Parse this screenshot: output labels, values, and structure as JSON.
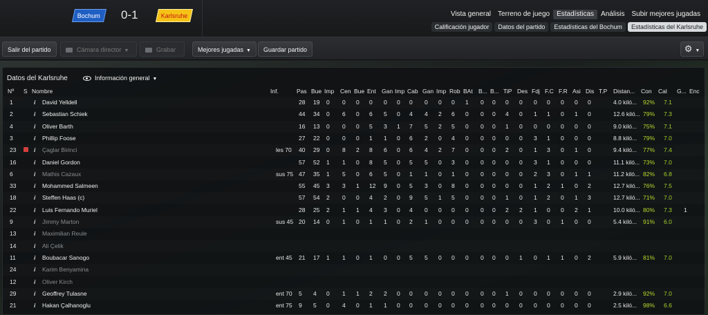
{
  "match": {
    "home_team": "Bochum",
    "away_team": "Karlsruhe",
    "score": "0-1",
    "home_color": "#1f5fc4",
    "away_color": "#f5c216"
  },
  "main_nav": [
    {
      "label": "Vista general",
      "active": false
    },
    {
      "label": "Terreno de juego",
      "active": false
    },
    {
      "label": "Estadísticas",
      "active": true
    },
    {
      "label": "Análisis",
      "active": false
    },
    {
      "label": "Subir mejores jugadas",
      "active": false
    }
  ],
  "sub_nav": [
    {
      "label": "Calificación jugador",
      "active": false
    },
    {
      "label": "Datos del partido",
      "active": false
    },
    {
      "label": "Estadísticas del Bochum",
      "active": false
    },
    {
      "label": "Estadísticas del Karlsruhe",
      "active": true
    }
  ],
  "toolbar": {
    "exit": "Salir del partido",
    "camera": "Cámara director",
    "record": "Grabar",
    "highlights": "Mejores jugadas",
    "save": "Guardar partido"
  },
  "panel": {
    "title": "Datos del Karlsruhe",
    "view": "Información general"
  },
  "columns": [
    "Nº",
    "S",
    "Nombre",
    "Inf.",
    "Pas",
    "Bue",
    "Imp",
    "Cen",
    "Bue",
    "Ent",
    "Gan",
    "Imp",
    "Cab",
    "Gan",
    "Imp",
    "Rob",
    "BAt",
    "B...",
    "B...",
    "TiP",
    "Des",
    "Fdj",
    "F.C",
    "F.R",
    "Asi",
    "Dis",
    "T.P",
    "Distan...",
    "Con",
    "Cal",
    "G...",
    "Enc"
  ],
  "rows": [
    {
      "no": "1",
      "name": "David Yelldell",
      "inf": "",
      "stats": [
        "28",
        "19",
        "0",
        "0",
        "0",
        "0",
        "0",
        "0",
        "0",
        "0",
        "0",
        "0",
        "1",
        "0",
        "0",
        "0",
        "0",
        "0",
        "0",
        "0",
        "0",
        "0"
      ],
      "dist": "4.0 kiló...",
      "con": "92%",
      "cal": "7.1",
      "g": "",
      "enc": "",
      "sub": false,
      "card": false
    },
    {
      "no": "2",
      "name": "Sebastian Schiek",
      "inf": "",
      "stats": [
        "44",
        "34",
        "0",
        "6",
        "0",
        "6",
        "5",
        "0",
        "4",
        "4",
        "2",
        "6",
        "0",
        "0",
        "0",
        "4",
        "0",
        "1",
        "1",
        "0",
        "1",
        "0"
      ],
      "dist": "12.6 kiló...",
      "con": "79%",
      "cal": "7.3",
      "g": "",
      "enc": "",
      "sub": false,
      "card": false
    },
    {
      "no": "4",
      "name": "Oliver Barth",
      "inf": "",
      "stats": [
        "16",
        "13",
        "0",
        "0",
        "0",
        "5",
        "3",
        "1",
        "7",
        "5",
        "2",
        "5",
        "0",
        "0",
        "0",
        "1",
        "0",
        "0",
        "0",
        "0",
        "0",
        "0"
      ],
      "dist": "9.0 kiló...",
      "con": "75%",
      "cal": "7.1",
      "g": "",
      "enc": "",
      "sub": false,
      "card": false
    },
    {
      "no": "3",
      "name": "Phillip Foose",
      "inf": "",
      "stats": [
        "27",
        "22",
        "0",
        "0",
        "0",
        "1",
        "1",
        "0",
        "6",
        "2",
        "0",
        "4",
        "0",
        "0",
        "0",
        "0",
        "0",
        "3",
        "1",
        "0",
        "0",
        "0"
      ],
      "dist": "8.8 kiló...",
      "con": "79%",
      "cal": "7.0",
      "g": "",
      "enc": "",
      "sub": false,
      "card": false
    },
    {
      "no": "23",
      "name": "Çaglar Birinci",
      "inf": "les 70",
      "stats": [
        "40",
        "29",
        "0",
        "8",
        "2",
        "8",
        "6",
        "0",
        "6",
        "4",
        "2",
        "7",
        "0",
        "0",
        "0",
        "2",
        "0",
        "1",
        "3",
        "0",
        "1",
        "0"
      ],
      "dist": "9.4 kiló...",
      "con": "77%",
      "cal": "7.4",
      "g": "",
      "enc": "",
      "sub": true,
      "card": true
    },
    {
      "no": "16",
      "name": "Daniel Gordon",
      "inf": "",
      "stats": [
        "57",
        "52",
        "1",
        "1",
        "0",
        "8",
        "5",
        "0",
        "5",
        "5",
        "0",
        "3",
        "0",
        "0",
        "0",
        "0",
        "0",
        "3",
        "1",
        "0",
        "0",
        "0"
      ],
      "dist": "11.1 kiló...",
      "con": "73%",
      "cal": "7.0",
      "g": "",
      "enc": "",
      "sub": false,
      "card": false
    },
    {
      "no": "6",
      "name": "Mathis Cazaux",
      "inf": "sus 75",
      "stats": [
        "47",
        "35",
        "1",
        "5",
        "0",
        "6",
        "5",
        "0",
        "1",
        "1",
        "0",
        "1",
        "0",
        "0",
        "0",
        "0",
        "0",
        "2",
        "3",
        "0",
        "1",
        "1"
      ],
      "dist": "11.2 kiló...",
      "con": "82%",
      "cal": "6.8",
      "g": "",
      "enc": "",
      "sub": true,
      "card": false
    },
    {
      "no": "33",
      "name": "Mohammed Salmeen",
      "inf": "",
      "stats": [
        "55",
        "45",
        "3",
        "3",
        "1",
        "12",
        "9",
        "0",
        "5",
        "3",
        "0",
        "8",
        "0",
        "0",
        "0",
        "0",
        "0",
        "1",
        "2",
        "1",
        "0",
        "2"
      ],
      "dist": "12.7 kiló...",
      "con": "76%",
      "cal": "7.5",
      "g": "",
      "enc": "",
      "sub": false,
      "card": false
    },
    {
      "no": "18",
      "name": "Steffen Haas (c)",
      "inf": "",
      "stats": [
        "57",
        "54",
        "2",
        "0",
        "0",
        "4",
        "2",
        "0",
        "9",
        "5",
        "1",
        "5",
        "0",
        "0",
        "0",
        "1",
        "0",
        "1",
        "2",
        "0",
        "1",
        "3"
      ],
      "dist": "12.7 kiló...",
      "con": "71%",
      "cal": "7.0",
      "g": "",
      "enc": "",
      "sub": false,
      "card": false
    },
    {
      "no": "22",
      "name": "Luis Fernando Muriel",
      "inf": "",
      "stats": [
        "28",
        "25",
        "2",
        "1",
        "1",
        "4",
        "3",
        "0",
        "4",
        "0",
        "0",
        "0",
        "0",
        "0",
        "0",
        "2",
        "2",
        "1",
        "0",
        "0",
        "2",
        "1"
      ],
      "dist": "10.0 kiló...",
      "con": "80%",
      "cal": "7.3",
      "g": "1",
      "enc": "",
      "sub": false,
      "card": false
    },
    {
      "no": "9",
      "name": "Jimmy Marton",
      "inf": "sus 45",
      "stats": [
        "20",
        "14",
        "0",
        "1",
        "0",
        "1",
        "1",
        "0",
        "2",
        "1",
        "0",
        "0",
        "0",
        "0",
        "0",
        "0",
        "0",
        "3",
        "0",
        "1",
        "0",
        "0"
      ],
      "dist": "5.4 kiló...",
      "con": "91%",
      "cal": "6.0",
      "g": "",
      "enc": "",
      "sub": true,
      "card": false
    },
    {
      "no": "13",
      "name": "Maximilian Reule",
      "inf": "",
      "stats": [],
      "dist": "",
      "con": "",
      "cal": "",
      "g": "",
      "enc": "",
      "sub": true,
      "card": false
    },
    {
      "no": "14",
      "name": "Ali Çelik",
      "inf": "",
      "stats": [],
      "dist": "",
      "con": "",
      "cal": "",
      "g": "",
      "enc": "",
      "sub": true,
      "card": false
    },
    {
      "no": "11",
      "name": "Boubacar Sanogo",
      "inf": "ent 45",
      "stats": [
        "21",
        "17",
        "1",
        "1",
        "0",
        "1",
        "0",
        "0",
        "5",
        "5",
        "0",
        "0",
        "0",
        "0",
        "0",
        "0",
        "1",
        "0",
        "1",
        "1",
        "0",
        "2"
      ],
      "dist": "5.9 kiló...",
      "con": "81%",
      "cal": "7.0",
      "g": "",
      "enc": "",
      "sub": false,
      "card": false
    },
    {
      "no": "24",
      "name": "Karim Benyamina",
      "inf": "",
      "stats": [],
      "dist": "",
      "con": "",
      "cal": "",
      "g": "",
      "enc": "",
      "sub": true,
      "card": false
    },
    {
      "no": "12",
      "name": "Oliver Kirch",
      "inf": "",
      "stats": [],
      "dist": "",
      "con": "",
      "cal": "",
      "g": "",
      "enc": "",
      "sub": true,
      "card": false
    },
    {
      "no": "29",
      "name": "Geoffrey Tulasne",
      "inf": "ent 70",
      "stats": [
        "5",
        "4",
        "0",
        "1",
        "1",
        "2",
        "2",
        "0",
        "0",
        "0",
        "0",
        "0",
        "0",
        "0",
        "0",
        "1",
        "0",
        "0",
        "0",
        "0",
        "0",
        "0"
      ],
      "dist": "2.9 kiló...",
      "con": "92%",
      "cal": "7.0",
      "g": "",
      "enc": "",
      "sub": false,
      "card": false
    },
    {
      "no": "21",
      "name": "Hakan Çalhanoglu",
      "inf": "ent 75",
      "stats": [
        "9",
        "5",
        "0",
        "4",
        "0",
        "1",
        "1",
        "0",
        "0",
        "0",
        "0",
        "0",
        "0",
        "0",
        "0",
        "0",
        "0",
        "0",
        "0",
        "0",
        "0",
        "0"
      ],
      "dist": "2.5 kiló...",
      "con": "98%",
      "cal": "6.6",
      "g": "",
      "enc": "",
      "sub": false,
      "card": false
    }
  ],
  "icons": {
    "camera": "camera-icon",
    "record": "record-icon",
    "settings": "gear-icon",
    "view": "eye-icon",
    "info": "info-icon"
  }
}
